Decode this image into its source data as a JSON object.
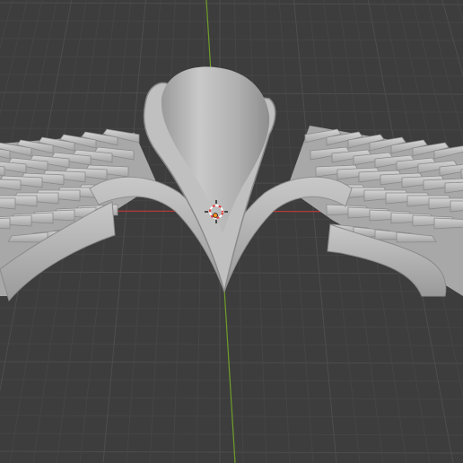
{
  "viewport": {
    "view": "3d-viewport",
    "model": "winged-badge-sculpt",
    "colors": {
      "background": "#3d3d3d",
      "grid_minor": "#454545",
      "grid_major": "#4d4d4d",
      "y_axis": "#6f9e2a",
      "x_axis": "#b33a3a",
      "model_shade": "#b8b8b8",
      "model_highlight": "#cfcfcf",
      "model_dark": "#8a8a8a",
      "cursor_red": "#e23b3b",
      "cursor_white": "#ffffff",
      "origin_orange": "#ff8c1a"
    },
    "icons": [
      "3d-cursor-icon",
      "object-origin-icon"
    ]
  }
}
